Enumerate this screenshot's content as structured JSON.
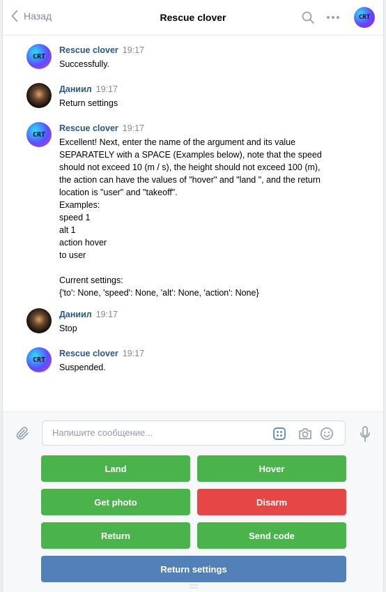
{
  "header": {
    "back_label": "Назад",
    "title": "Rescue clover",
    "avatar_text": "CRT"
  },
  "messages": [
    {
      "author": "Rescue clover",
      "time": "19:17",
      "avatar": "bot",
      "avatar_text": "CRT",
      "text": "Successfully."
    },
    {
      "author": "Даниил",
      "time": "19:17",
      "avatar": "user",
      "avatar_text": "",
      "text": "Return settings"
    },
    {
      "author": "Rescue clover",
      "time": "19:17",
      "avatar": "bot",
      "avatar_text": "CRT",
      "text": "Excellent! Next, enter the name of the argument and its value SEPARATELY with a SPACE (Examples below), note that the speed should not exceed 10 (m / s), the height should not exceed 100 (m), the action can have the values of \"hover\" and \"land \", and the return location is \"user\" and \"takeoff\".\nExamples:\nspeed 1\nalt 1\naction hover\nto user\n\nCurrent settings:\n{'to': None, 'speed': None, 'alt': None, 'action': None}"
    },
    {
      "author": "Даниил",
      "time": "19:17",
      "avatar": "user",
      "avatar_text": "",
      "text": "Stop"
    },
    {
      "author": "Rescue clover",
      "time": "19:17",
      "avatar": "bot",
      "avatar_text": "CRT",
      "text": "Suspended."
    }
  ],
  "composer": {
    "placeholder": "Напишите сообщение...",
    "value": ""
  },
  "keyboard": {
    "land": "Land",
    "hover": "Hover",
    "get_photo": "Get photo",
    "disarm": "Disarm",
    "return": "Return",
    "send_code": "Send code",
    "return_settings": "Return settings"
  },
  "colors": {
    "positive": "#4bb34b",
    "negative": "#e64646",
    "primary": "#5181b8",
    "author": "#2a5885"
  }
}
